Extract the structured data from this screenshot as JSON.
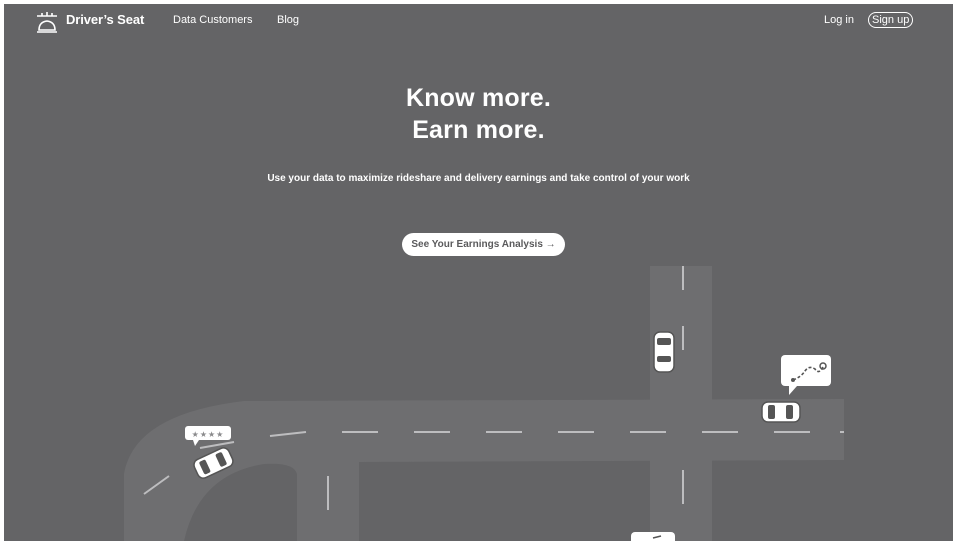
{
  "nav": {
    "brand": "Driver’s Seat",
    "links": [
      {
        "label": "Data Customers"
      },
      {
        "label": "Blog"
      }
    ],
    "login_label": "Log in",
    "signup_label": "Sign up"
  },
  "hero": {
    "headline_line1": "Know more.",
    "headline_line2": "Earn more.",
    "subheading": "Use your data to maximize rideshare and delivery earnings and take control of your work",
    "cta_label": "See Your Earnings Analysis →"
  },
  "illustration": {
    "rating_badge": "★★★★",
    "icons": [
      "car-seat-logo-icon",
      "car-icon",
      "route-map-icon",
      "rating-stars-icon"
    ]
  },
  "colors": {
    "background": "#646466",
    "road": "#6e6e70",
    "lane_marking": "#bdbdbf",
    "text": "#ffffff",
    "cta_background": "#ffffff"
  }
}
